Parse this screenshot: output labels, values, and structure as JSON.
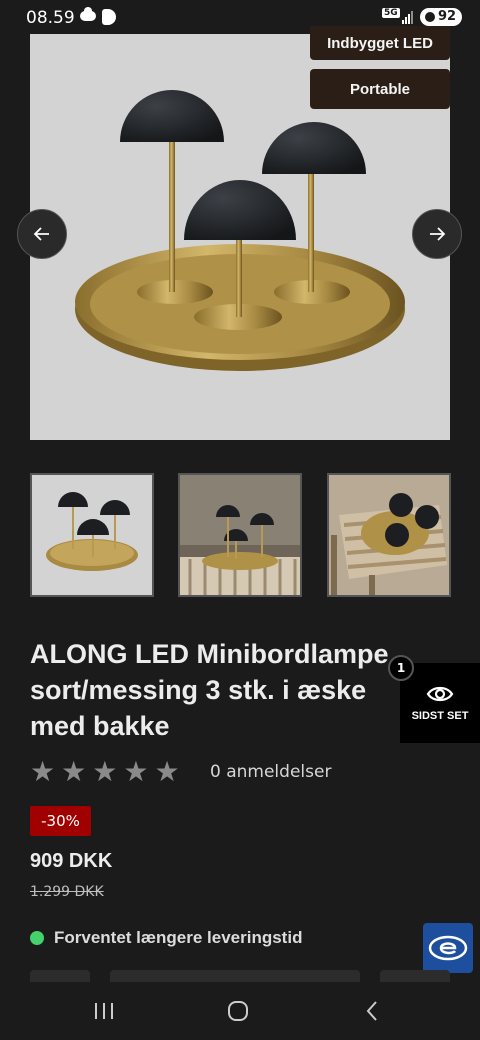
{
  "status_bar": {
    "time": "08.59",
    "network": "5G",
    "battery": "92"
  },
  "hero": {
    "badges": [
      "Indbygget LED",
      "Portable"
    ],
    "prev_icon": "arrow-left-icon",
    "next_icon": "arrow-right-icon"
  },
  "thumbnails": [
    "lamp-tray-photo",
    "lamp-bench-photo",
    "lamp-stool-photo"
  ],
  "product": {
    "title_lines": [
      "ALONG LED Minibordlampe",
      "sort/messing 3 stk. i æske",
      "med bakke"
    ],
    "rating_stars": 5,
    "rating_value": 0,
    "reviews_text": "0 anmeldelser",
    "discount": "-30%",
    "price": "909 DKK",
    "old_price": "1.299 DKK",
    "delivery": "Forventet længere leveringstid"
  },
  "recently_seen": {
    "label": "SIDST SET",
    "count": "1"
  },
  "colors": {
    "background": "#1b1b1b",
    "badge": "#2b1e17",
    "discount": "#a10000",
    "delivery_dot": "#45d16b",
    "trust_badge": "#1e4f9e"
  }
}
